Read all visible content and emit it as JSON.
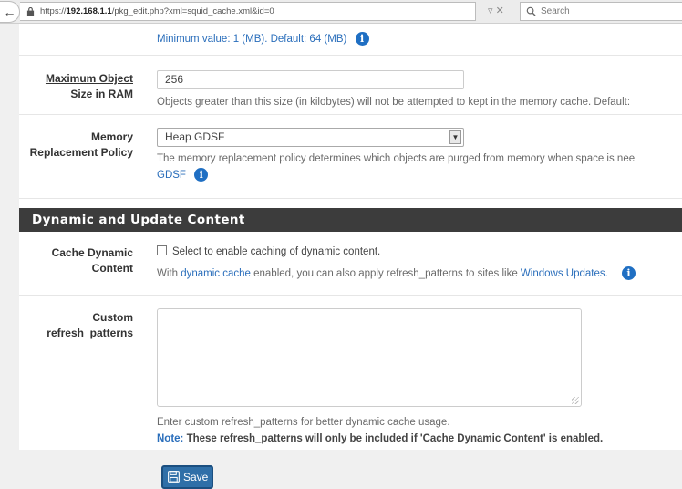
{
  "browser": {
    "url_scheme": "https://",
    "url_host": "192.168.1.1",
    "url_path": "/pkg_edit.php?xml=squid_cache.xml&id=0",
    "url_actions": "▿ ✕",
    "search_placeholder": "Search"
  },
  "top_help": {
    "text": "Minimum value: 1 (MB). Default: 64 (MB)"
  },
  "max_object": {
    "label_line1": "Maximum Object",
    "label_line2": "Size in RAM",
    "value": "256",
    "help": "Objects greater than this size (in kilobytes) will not be attempted to kept in the memory cache. Default:"
  },
  "memory_policy": {
    "label_line1": "Memory",
    "label_line2": "Replacement Policy",
    "selected": "Heap GDSF",
    "help": "The memory replacement policy determines which objects are purged from memory when space is nee",
    "default_link": "GDSF"
  },
  "section": {
    "title": "Dynamic and Update Content"
  },
  "cache_dynamic": {
    "label_line1": "Cache Dynamic",
    "label_line2": "Content",
    "checkbox_label": "Select to enable caching of dynamic content.",
    "help_prefix": "With",
    "help_link1": "dynamic cache",
    "help_middle": "enabled, you can also apply refresh_patterns to sites like",
    "help_link2": "Windows Updates."
  },
  "refresh_patterns": {
    "label_line1": "Custom",
    "label_line2": "refresh_patterns",
    "value": "",
    "help": "Enter custom refresh_patterns for better dynamic cache usage.",
    "note_label": "Note:",
    "note_text": "These refresh_patterns will only be included if 'Cache Dynamic Content' is enabled."
  },
  "save_button": {
    "label": "Save"
  },
  "icons": {
    "info": "info-icon",
    "save": "floppy-disk-icon",
    "lock": "lock-icon",
    "search": "search-icon",
    "back": "back-arrow-icon"
  },
  "colors": {
    "section_header_bg": "#3c3c3c",
    "link": "#2a6ebb",
    "save_button_bg": "#2f6fa8",
    "info_icon": "#1f6fc3"
  }
}
